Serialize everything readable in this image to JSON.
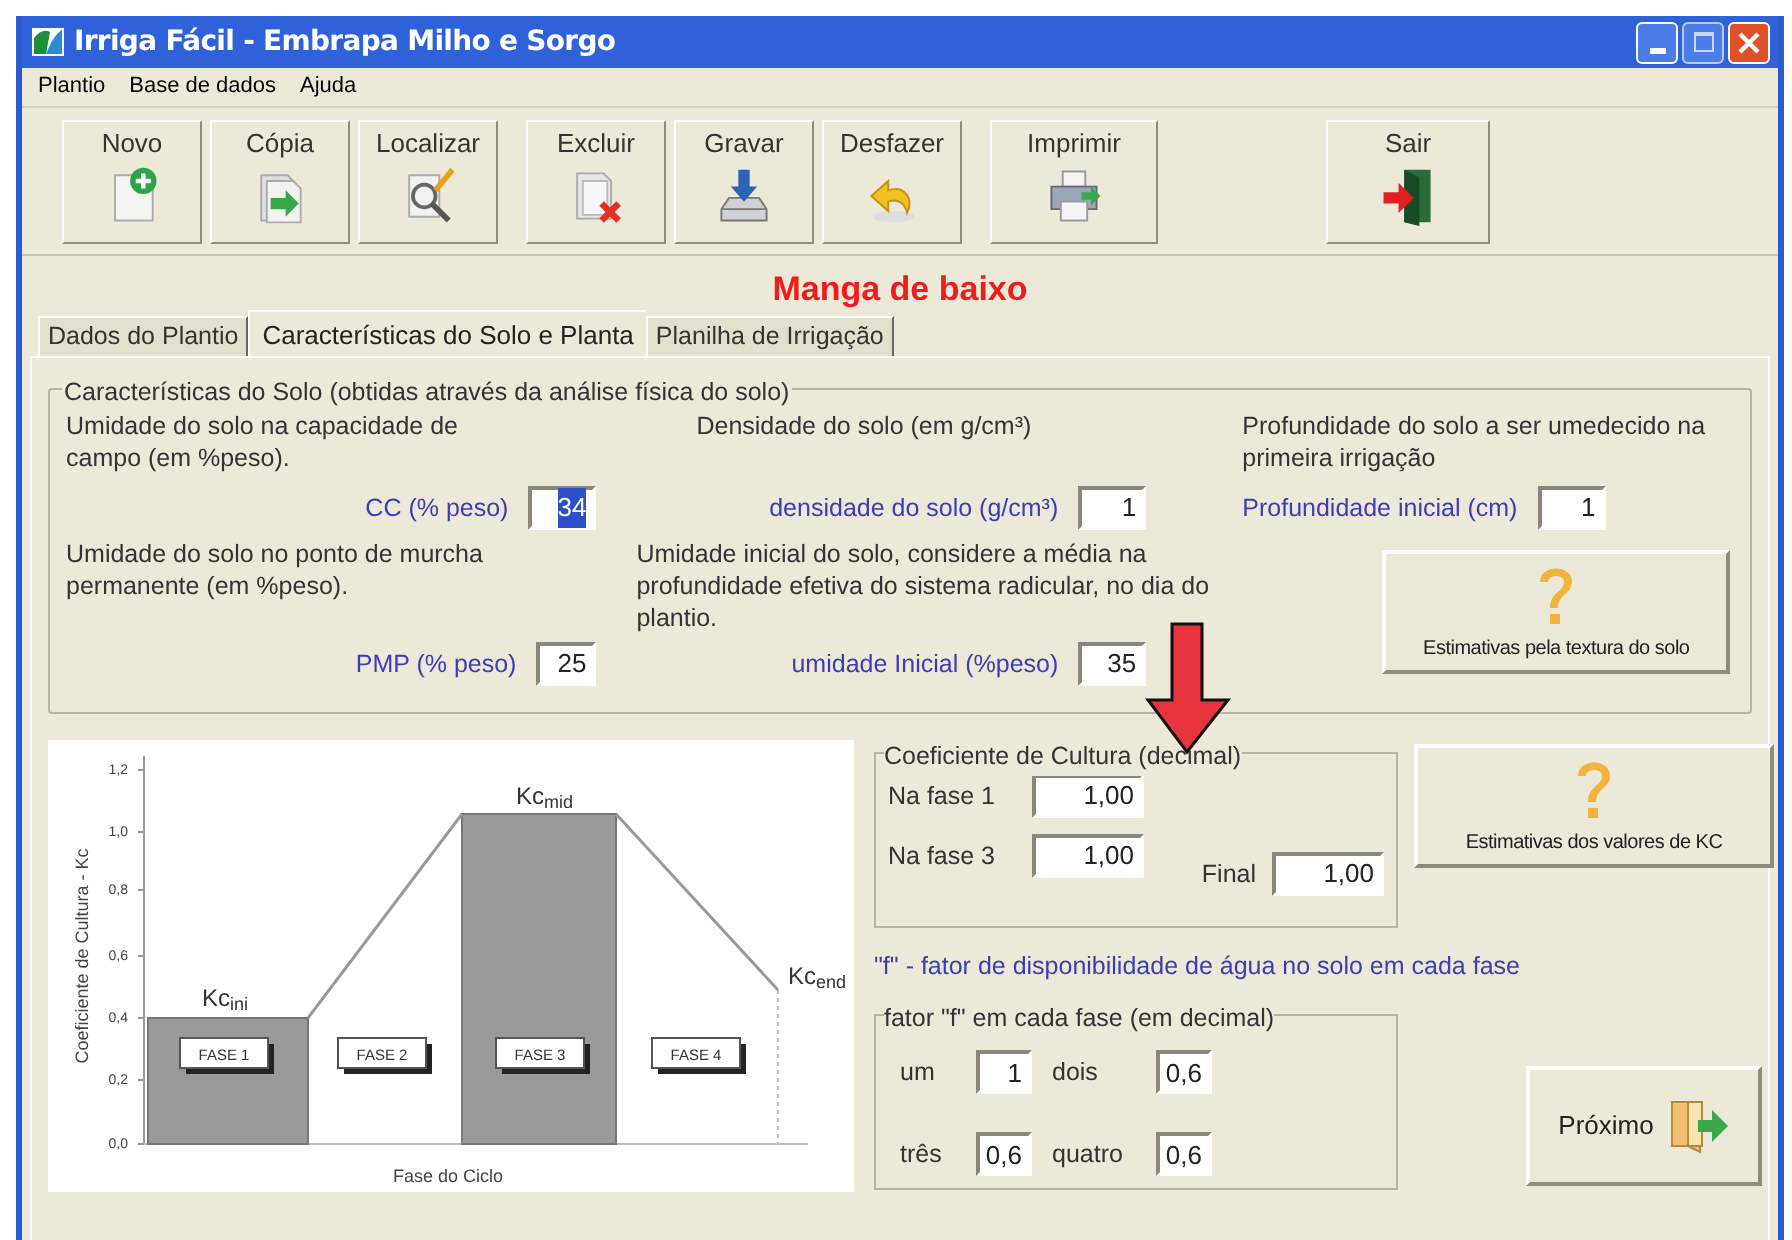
{
  "window": {
    "title": "Irriga Fácil  - Embrapa Milho e Sorgo"
  },
  "menu": [
    {
      "label": "Plantio"
    },
    {
      "label": "Base de dados"
    },
    {
      "label": "Ajuda"
    }
  ],
  "toolbar": [
    [
      {
        "label": "Novo",
        "kind": "new"
      },
      {
        "label": "Cópia",
        "kind": "copy"
      },
      {
        "label": "Localizar",
        "kind": "find"
      }
    ],
    [
      {
        "label": "Excluir",
        "kind": "delete"
      },
      {
        "label": "Gravar",
        "kind": "save"
      },
      {
        "label": "Desfazer",
        "kind": "undo"
      }
    ],
    [
      {
        "label": "Imprimir",
        "kind": "print"
      }
    ],
    [
      {
        "label": "Sair",
        "kind": "exit"
      }
    ]
  ],
  "heading": "Manga de baixo",
  "tabs": [
    {
      "label": "Dados do Plantio",
      "selected": false
    },
    {
      "label": "Características do Solo e  Planta",
      "selected": true
    },
    {
      "label": "Planilha de Irrigação",
      "selected": false
    }
  ],
  "soil_group": {
    "legend": "Características do Solo (obtidas através da análise física do solo)",
    "columns": [
      [
        {
          "description": "Umidade do solo na capacidade de campo (em %peso).",
          "label": "CC (% peso)",
          "value": "34",
          "highlighted": true
        },
        {
          "description": "Umidade do solo no ponto de murcha permanente (em %peso).",
          "label": "PMP (% peso)",
          "value": "25",
          "highlighted": false
        }
      ],
      [
        {
          "description": "Densidade do solo (em g/cm³)",
          "label": "densidade do solo (g/cm³)",
          "value": "1",
          "highlighted": false
        },
        {
          "description": "Umidade inicial do solo, considere a média na profundidade efetiva do sistema radicular, no dia do plantio.",
          "label": "umidade Inicial  (%peso)",
          "value": "35",
          "highlighted": false
        }
      ],
      [
        {
          "description": "Profundidade do solo a ser umedecido na primeira irrigação",
          "label": "Profundidade inicial (cm)",
          "value": "1",
          "highlighted": false
        }
      ]
    ],
    "button": "Estimativas pela textura do solo"
  },
  "chart": {
    "ylabel": "Coeficiente de Cultura - Kc",
    "xlabel": "Fase do Ciclo",
    "y_tick_labels": [
      "1,2",
      "1,0",
      "0,8",
      "0,6",
      "0,4",
      "0,2",
      "0,0"
    ],
    "kc_labels": [
      "Kc$_{ini}$",
      "Kc$_{mid}$",
      "Kc$_{end}$"
    ],
    "phases": [
      "FASE 1",
      "FASE 2",
      "FASE 3",
      "FASE 4"
    ]
  },
  "coef_group": {
    "legend": "Coeficiente de Cultura (decimal)",
    "fase1_label": "Na fase 1",
    "fase1": "1,00",
    "fase3_label": "Na fase 3",
    "fase3": "1,00",
    "final_label": "Final",
    "final": "1,00"
  },
  "kc_button": "Estimativas dos valores de KC",
  "f_note": "\"f\" - fator de disponibilidade de água no solo em cada fase",
  "f_group": {
    "legend": "fator \"f\" em cada fase (em decimal)",
    "items": [
      {
        "label": "um",
        "value": "1"
      },
      {
        "label": "dois",
        "value": "0,6"
      },
      {
        "label": "três",
        "value": "0,6"
      },
      {
        "label": "quatro",
        "value": "0,6"
      }
    ]
  },
  "next_button": "Próximo"
}
